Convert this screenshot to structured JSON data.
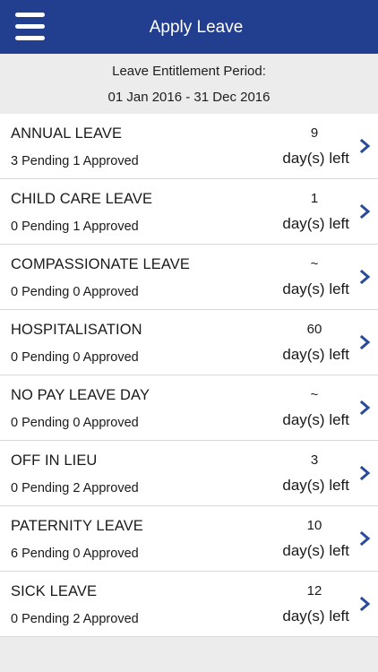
{
  "header": {
    "title": "Apply Leave",
    "menu_icon": "hamburger-menu-icon",
    "background_color": "#223f8f"
  },
  "period": {
    "label": "Leave Entitlement Period:",
    "range": "01 Jan 2016 - 31 Dec 2016"
  },
  "leaves": [
    {
      "name": "ANNUAL LEAVE",
      "status": "3 Pending 1 Approved",
      "count": "9",
      "unit": "day(s) left"
    },
    {
      "name": "CHILD CARE LEAVE",
      "status": "0 Pending 1 Approved",
      "count": "1",
      "unit": "day(s) left"
    },
    {
      "name": "COMPASSIONATE LEAVE",
      "status": "0 Pending 0 Approved",
      "count": "~",
      "unit": "day(s) left"
    },
    {
      "name": "HOSPITALISATION",
      "status": "0 Pending 0 Approved",
      "count": "60",
      "unit": "day(s) left"
    },
    {
      "name": "NO PAY LEAVE DAY",
      "status": "0 Pending 0 Approved",
      "count": "~",
      "unit": "day(s) left"
    },
    {
      "name": "OFF IN LIEU",
      "status": "0 Pending 2 Approved",
      "count": "3",
      "unit": "day(s) left"
    },
    {
      "name": "PATERNITY LEAVE",
      "status": "6 Pending 0 Approved",
      "count": "10",
      "unit": "day(s) left"
    },
    {
      "name": "SICK LEAVE",
      "status": "0 Pending 2 Approved",
      "count": "12",
      "unit": "day(s) left"
    }
  ],
  "chevron_icon": "chevron-right-icon",
  "chevron_color": "#2a4a9a"
}
